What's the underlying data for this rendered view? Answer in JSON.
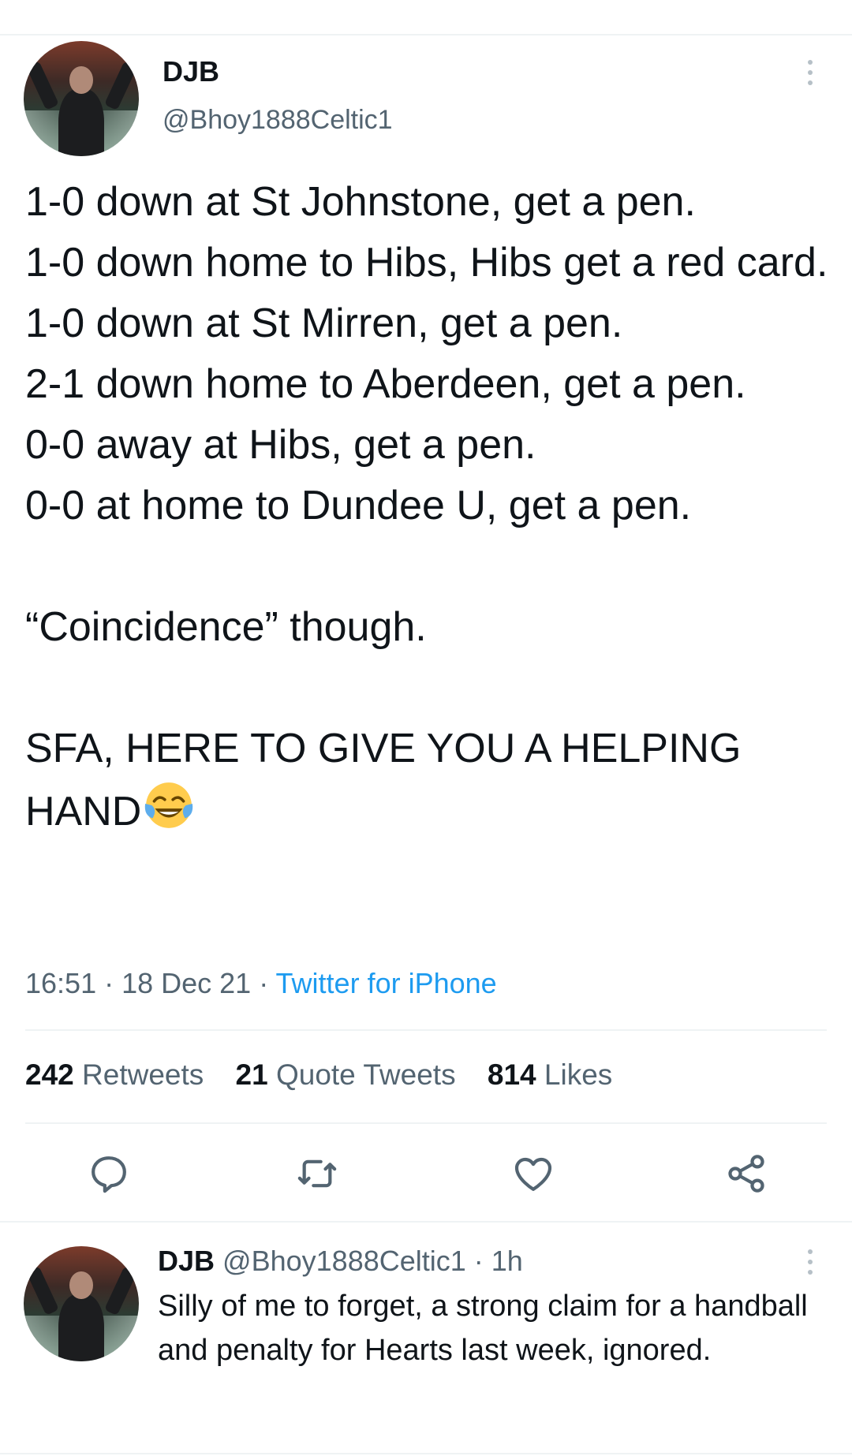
{
  "tweet": {
    "display_name": "DJB",
    "handle": "@Bhoy1888Celtic1",
    "text": "1-0 down at St Johnstone, get a pen.\n1-0 down home to Hibs, Hibs get a red card.\n1-0 down at St Mirren, get a pen.\n2-1 down home to Aberdeen, get a pen.\n0-0 away at Hibs, get a pen.\n0-0 at home to Dundee U, get a pen.\n\n“Coincidence” though.\n\nSFA, HERE TO GIVE YOU A HELPING HAND",
    "emoji": "face-with-tears-of-joy",
    "time": "16:51",
    "date": "18 Dec 21",
    "separator": " · ",
    "source": "Twitter for iPhone",
    "stats": {
      "retweets_count": "242",
      "retweets_label": "Retweets",
      "quote_count": "21",
      "quote_label": "Quote Tweets",
      "likes_count": "814",
      "likes_label": "Likes"
    },
    "actions": [
      "reply-icon",
      "retweet-icon",
      "like-icon",
      "share-icon"
    ]
  },
  "reply": {
    "display_name": "DJB",
    "handle": "@Bhoy1888Celtic1",
    "time": "1h",
    "separator": " · ",
    "text": "Silly of me to forget, a strong claim for a handball and penalty for Hearts last week, ignored."
  },
  "colors": {
    "text": "#0f1419",
    "secondary": "#536471",
    "link": "#1d9bf0",
    "divider": "#eff3f4"
  }
}
